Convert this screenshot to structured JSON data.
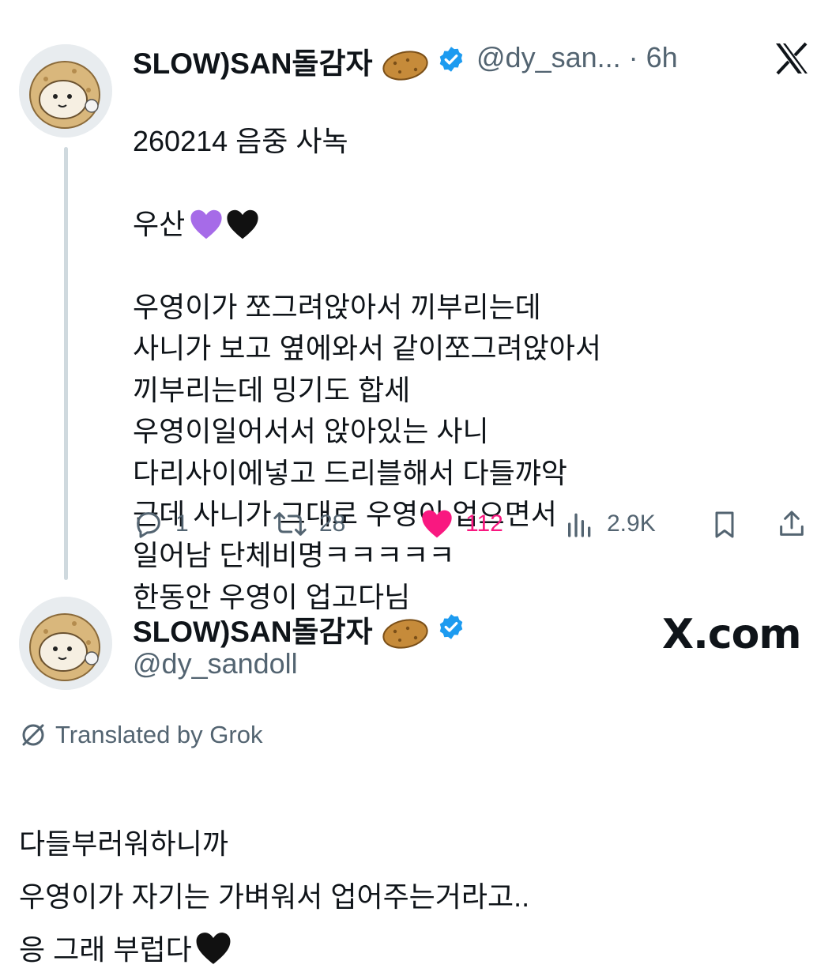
{
  "tweet": {
    "display_name": "SLOW)SAN돌감자",
    "handle_time": "@dy_san... · 6h",
    "body": "260214 음중 사녹\n우산\n우영이가 쪼그려앉아서 끼부리는데\n사니가 보고 옆에와서 같이쪼그려앉아서\n끼부리는데 밍기도 합세\n우영이일어서서 앉아있는 사니\n다리사이에넣고 드리블해서 다들꺄악\n근데 사니가 그대로 우영이 업으면서\n일어남 단체비명ㅋㅋㅋㅋㅋ\n한동안 우영이 업고다님",
    "body_line1": "260214 음중 사녹",
    "body_line2": "우산",
    "body_rest": "우영이가 쪼그려앉아서 끼부리는데\n사니가 보고 옆에와서 같이쪼그려앉아서\n끼부리는데 밍기도 합세\n우영이일어서서 앉아있는 사니\n다리사이에넣고 드리블해서 다들꺄악\n근데 사니가 그대로 우영이 업으면서\n일어남 단체비명ㅋㅋㅋㅋㅋ\n한동안 우영이 업고다님",
    "actions": {
      "replies": "1",
      "reposts": "28",
      "likes": "112",
      "views": "2.9K"
    }
  },
  "reply": {
    "display_name": "SLOW)SAN돌감자",
    "handle": "@dy_sandoll",
    "site_label": "X.com",
    "translated_label": "Translated by Grok",
    "body": "다들부러워하니까\n우영이가 자기는 가벼워서 업어주는거라고..\n응 그래 부럽다"
  },
  "colors": {
    "like_pink": "#f91880",
    "verified_blue": "#1d9bf0",
    "secondary_text": "#536471"
  },
  "icons": [
    "reply-icon",
    "repost-icon",
    "heart-icon",
    "views-icon",
    "bookmark-icon",
    "share-icon",
    "verified-badge-icon",
    "x-logo-icon",
    "potato-emoji",
    "purple-heart-emoji",
    "black-heart-emoji",
    "translate-icon"
  ]
}
